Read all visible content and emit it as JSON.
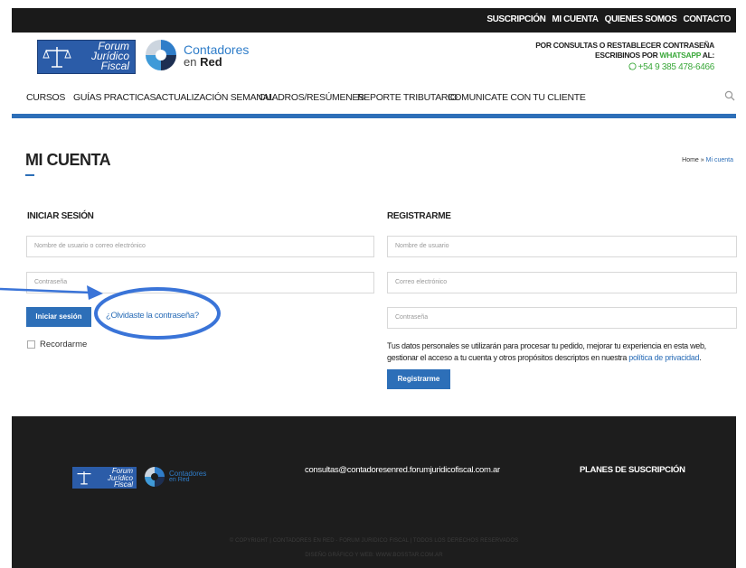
{
  "topbar": {
    "links": [
      "SUSCRIPCIÓN",
      "MI CUENTA",
      "QUIENES SOMOS",
      "CONTACTO"
    ]
  },
  "logos": {
    "forum": [
      "Forum",
      "Jurídico",
      "Fiscal"
    ],
    "contadores_line1": "Contadores",
    "contadores_line2_pre": "en ",
    "contadores_line2_bold": "Red"
  },
  "whatsapp": {
    "line1": "POR CONSULTAS O RESTABLECER CONTRASEÑA",
    "line2_pre": "ESCRIBINOS POR ",
    "line2_highlight": "WHATSAPP",
    "line2_post": " AL:",
    "phone": "+54 9 385 478-6466"
  },
  "nav": {
    "items": [
      "CURSOS",
      "GUÍAS PRACTICAS",
      "ACTUALIZACIÓN SEMANAL",
      "CUADROS/RESÚMENES",
      "REPORTE TRIBUTARIO",
      "COMUNICATE CON TU CLIENTE"
    ],
    "search_icon": "search-icon"
  },
  "page": {
    "title": "MI CUENTA",
    "breadcrumb_home": "Home",
    "breadcrumb_sep": " » ",
    "breadcrumb_current": "Mi cuenta"
  },
  "login": {
    "title": "INICIAR SESIÓN",
    "username_placeholder": "Nombre de usuario o correo electrónico",
    "password_placeholder": "Contraseña",
    "submit": "Iniciar sesión",
    "forgot": "¿Olvidaste la contraseña?",
    "remember": "Recordarme"
  },
  "register": {
    "title": "REGISTRARME",
    "username_placeholder": "Nombre de usuario",
    "email_placeholder": "Correo electrónico",
    "password_placeholder": "Contraseña",
    "privacy_text": "Tus datos personales se utilizarán para procesar tu pedido, mejorar tu experiencia en esta web, gestionar el acceso a tu cuenta y otros propósitos descriptos en nuestra ",
    "privacy_link": "política de privacidad",
    "privacy_end": ".",
    "submit": "Registrarme"
  },
  "footer": {
    "forum": [
      "Forum",
      "Jurídico",
      "Fiscal"
    ],
    "contadores_line1": "Contadores",
    "contadores_line2": "en Red",
    "email": "consultas@contadoresenred.forumjuridicofiscal.com.ar",
    "plans": "PLANES DE SUSCRIPCIÓN",
    "copyright": "© COPYRIGHT | CONTADORES EN RED - FORUM JURIDICO FISCAL | TODOS LOS DERECHOS RESERVADOS",
    "design": "DISEÑO GRÁFICO Y WEB: WWW.BOSSTAR.COM.AR"
  },
  "colors": {
    "accent": "#2d6fb8",
    "whatsapp": "#3aa83a",
    "annotation": "#3a74d8"
  }
}
